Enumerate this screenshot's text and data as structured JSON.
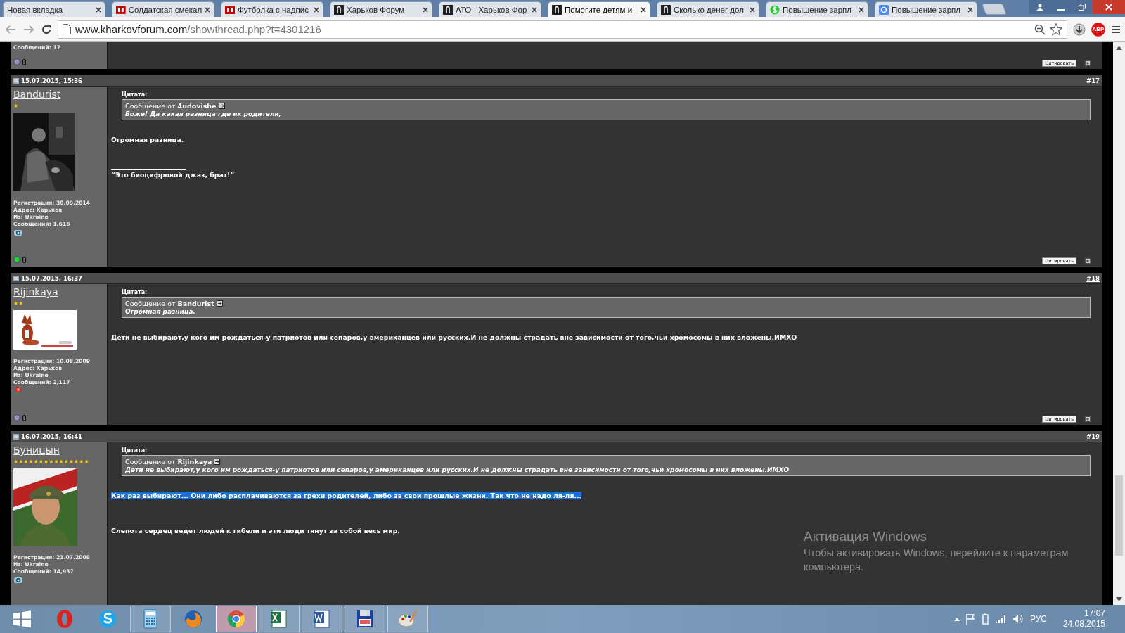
{
  "browser": {
    "tabs": [
      {
        "title": "Новая вкладка",
        "selected": false
      },
      {
        "title": "Солдатская смекал",
        "selected": false
      },
      {
        "title": "Футболка с надпис",
        "selected": false
      },
      {
        "title": "Харьков Форум",
        "selected": false
      },
      {
        "title": "АТО - Харьков Фор",
        "selected": false
      },
      {
        "title": "Помогите детям и",
        "selected": true
      },
      {
        "title": "Сколько денег дол",
        "selected": false
      },
      {
        "title": "Повышение зарпл",
        "selected": false
      },
      {
        "title": "Повышение зарпл",
        "selected": false
      }
    ],
    "url": {
      "host": "www.kharkovforum.com",
      "path": "/showthread.php?t=4301216"
    },
    "adblock_label": "ABP"
  },
  "posts": [
    {
      "kind": "partial",
      "info": [
        "Сообщений: 17"
      ],
      "online": false,
      "quote_button": "Цитировать"
    },
    {
      "kind": "full",
      "date": "15.07.2015, 15:36",
      "number": "#17",
      "username": "Bandurist",
      "rank": "★",
      "info": [
        "Регистрация: 30.09.2014",
        "Адрес: Харьков",
        "Из: Ukraine",
        "Сообщений: 1,616"
      ],
      "online": true,
      "quote": {
        "label": "Цитата:",
        "from": "Сообщение от **4udovishe**",
        "text": "Боже! Да какая разница где их родители,"
      },
      "message": "Огромная разница.",
      "selected": false,
      "signature": "“Это биоцифровой джаз, брат!”",
      "quote_button": "Цитировать"
    },
    {
      "kind": "full",
      "date": "15.07.2015, 16:37",
      "number": "#18",
      "username": "Rijinkaya",
      "rank": "★★",
      "info": [
        "Регистрация: 10.08.2009",
        "Адрес: Харьков",
        "Из: Ukraine",
        "Сообщений: 2,117"
      ],
      "online": false,
      "quote": {
        "label": "Цитата:",
        "from": "Сообщение от **Bandurist**",
        "text": "Огромная разница."
      },
      "message": "Дети не выбирают,у кого им рождаться-у патриотов или сепаров,у американцев или русских.И не должны страдать вне зависимости от того,чьи хромосомы в них вложены.ИМХО",
      "selected": false,
      "quote_button": "Цитировать"
    },
    {
      "kind": "full",
      "date": "16.07.2015, 16:41",
      "number": "#19",
      "username": "Буницын",
      "rank": "★★★★★★★★★★★★★★★",
      "info": [
        "Регистрация: 21.07.2008",
        "Из: Ukraine",
        "Сообщений: 14,937"
      ],
      "quote": {
        "label": "Цитата:",
        "from": "Сообщение от **Rijinkaya**",
        "text": "Дети не выбирают,у кого им рождаться-у патриотов или сепаров,у американцев или русских.И не должны страдать вне зависимости от того,чьи хромосомы в них вложены.ИМХО"
      },
      "message": "Как раз выбирают... Они либо расплачиваются за грехи родителей, либо за свои прошлые жизни. Так что не надо ля-ля...",
      "selected": true,
      "signature": "Слепота сердец ведет людей к гибели и эти люди тянут за собой весь мир."
    }
  ],
  "activation": {
    "title": "Активация Windows",
    "text": "Чтобы активировать Windows, перейдите к параметрам компьютера."
  },
  "taskbar": {
    "apps": [
      {
        "kind": "start",
        "running": false,
        "selected": false
      },
      {
        "kind": "opera",
        "running": false,
        "selected": false
      },
      {
        "kind": "skype",
        "running": false,
        "selected": false
      },
      {
        "kind": "calculator",
        "running": true,
        "selected": false
      },
      {
        "kind": "firefox",
        "running": false,
        "selected": false
      },
      {
        "kind": "chrome",
        "running": true,
        "selected": true
      },
      {
        "kind": "excel",
        "running": true,
        "selected": false
      },
      {
        "kind": "word",
        "running": true,
        "selected": false
      },
      {
        "kind": "floppy",
        "running": true,
        "selected": false
      },
      {
        "kind": "paint",
        "running": true,
        "selected": false
      }
    ],
    "language": "РУС",
    "time": "17:07",
    "date": "24.08.2015"
  }
}
